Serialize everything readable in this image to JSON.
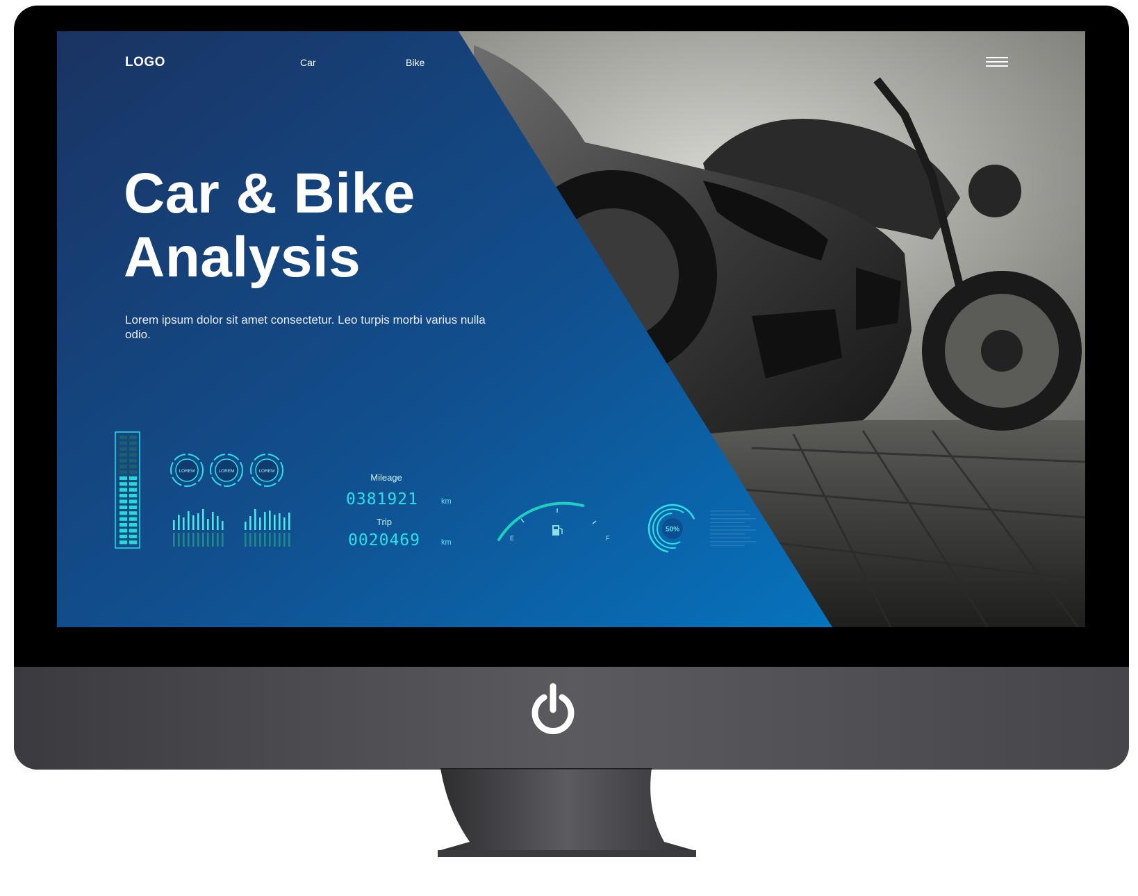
{
  "nav": {
    "logo": "LOGO",
    "links": [
      "Car",
      "Bike"
    ]
  },
  "hero": {
    "title_line1": "Car & Bike",
    "title_line2": "Analysis",
    "subtitle": "Lorem ipsum dolor sit amet consectetur. Leo turpis morbi varius nulla odio."
  },
  "dashboard": {
    "dials": [
      "LOREM",
      "LOREM",
      "LOREM"
    ],
    "mileage_label": "Mileage",
    "mileage_value": "0381921",
    "trip_label": "Trip",
    "trip_value": "0020469",
    "unit": "km",
    "fuel_empty": "E",
    "fuel_full": "F",
    "gauge_percent": "50%"
  },
  "colors": {
    "panel_dark": "#1a3362",
    "panel_light": "#0673bd",
    "accent_cyan": "#28e0e8",
    "monitor_chin": "#4a4a4f"
  },
  "icons": [
    "menu-icon",
    "fuel-pump-icon",
    "power-icon"
  ]
}
